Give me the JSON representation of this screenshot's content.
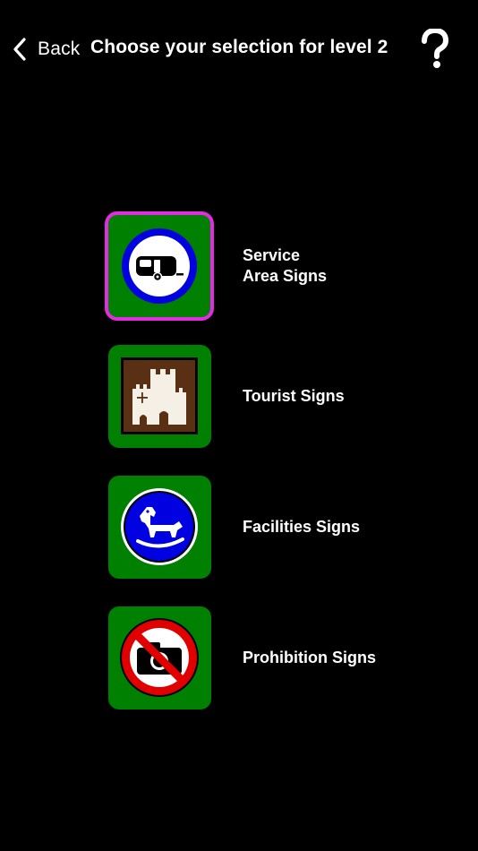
{
  "nav": {
    "back_label": "Back",
    "title": "Choose your selection for level 2",
    "help_icon": "question-mark-icon"
  },
  "colors": {
    "background": "#000000",
    "tile_green": "#008000",
    "selection_magenta": "#e22be2",
    "sign_blue": "#0000e0",
    "sign_brown": "#5a3014",
    "sign_red": "#e00000",
    "text": "#ffffff"
  },
  "items": [
    {
      "label": "Service\nArea Signs",
      "icon": "caravan-sign-icon",
      "selected": true
    },
    {
      "label": "Tourist Signs",
      "icon": "castle-sign-icon",
      "selected": false
    },
    {
      "label": "Facilities Signs",
      "icon": "rocking-horse-sign-icon",
      "selected": false
    },
    {
      "label": "Prohibition Signs",
      "icon": "no-camera-sign-icon",
      "selected": false
    }
  ]
}
